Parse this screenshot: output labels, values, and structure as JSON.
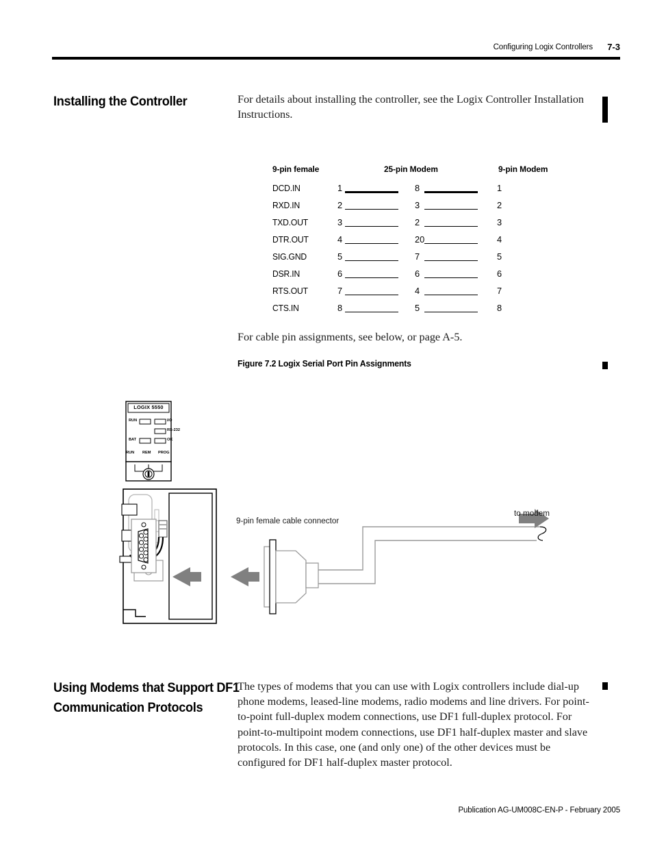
{
  "header": {
    "running_title": "Configuring Logix Controllers",
    "page_number": "7-3"
  },
  "sections": [
    {
      "heading": "Installing the Controller",
      "body": "For details about installing the controller, see the Logix Controller Installation Instructions."
    },
    {
      "heading": "Using Modems that Support DF1 Communication Protocols",
      "body": "The types of modems that you can use with Logix controllers include dial-up phone modems, leased-line modems, radio modems and line drivers. For point-to-point full-duplex modem connections, use DF1 full-duplex protocol. For point-to-multipoint modem connections, use DF1 half-duplex master and slave protocols. In this case, one (and only one) of the other devices must be configured for DF1 half-duplex master protocol."
    }
  ],
  "pin_table": {
    "columns": [
      "9-pin female",
      "25-pin Modem",
      "9-pin Modem"
    ],
    "rows": [
      {
        "signal": "DCD.IN",
        "pin_9f": "1",
        "pin_25m": "8",
        "pin_9m": "1"
      },
      {
        "signal": "RXD.IN",
        "pin_9f": "2",
        "pin_25m": "3",
        "pin_9m": "2"
      },
      {
        "signal": "TXD.OUT",
        "pin_9f": "3",
        "pin_25m": "2",
        "pin_9m": "3"
      },
      {
        "signal": "DTR.OUT",
        "pin_9f": "4",
        "pin_25m": "20",
        "pin_9m": "4"
      },
      {
        "signal": "SIG.GND",
        "pin_9f": "5",
        "pin_25m": "7",
        "pin_9m": "5"
      },
      {
        "signal": "DSR.IN",
        "pin_9f": "6",
        "pin_25m": "6",
        "pin_9m": "6"
      },
      {
        "signal": "RTS.OUT",
        "pin_9f": "7",
        "pin_25m": "4",
        "pin_9m": "7"
      },
      {
        "signal": "CTS.IN",
        "pin_9f": "8",
        "pin_25m": "5",
        "pin_9m": "8"
      }
    ]
  },
  "cable_note": "For cable pin assignments, see below, or page A-5.",
  "figure": {
    "caption": "Figure 7.2 Logix Serial Port Pin Assignments",
    "module_name": "LOGIX 5550",
    "leds": {
      "run": "RUN",
      "io": "I/O",
      "rs232": "RS-232",
      "bat": "BAT",
      "ok": "OK"
    },
    "keyswitch": {
      "run": "RUN",
      "rem": "REM",
      "prog": "PROG"
    },
    "connector_label": "9-pin female cable connector",
    "modem_label": "to modem"
  },
  "footer": "Publication AG-UM008C-EN-P - February 2005",
  "colors": {
    "ink": "#000000",
    "body_text": "#1a1a1a",
    "arrow_gray": "#808080",
    "line_gray": "#9a9a9a"
  }
}
